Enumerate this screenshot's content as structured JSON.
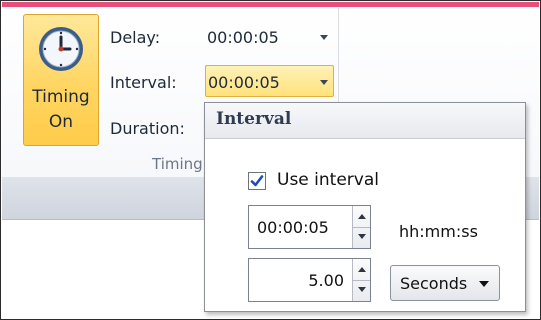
{
  "ribbon": {
    "timing_button": {
      "line1": "Timing",
      "line2": "On",
      "icon": "clock-icon"
    },
    "delay": {
      "label": "Delay:",
      "value": "00:00:05"
    },
    "interval": {
      "label": "Interval:",
      "value": "00:00:05"
    },
    "duration": {
      "label": "Duration:"
    },
    "group_label": "Timing"
  },
  "popup": {
    "title": "Interval",
    "use_interval": {
      "label": "Use interval",
      "checked": true
    },
    "time_field": {
      "value": "00:00:05",
      "format_label": "hh:mm:ss"
    },
    "number_field": {
      "value": "5.00"
    },
    "unit_dropdown": {
      "value": "Seconds"
    }
  },
  "colors": {
    "ribbon_accent": "#e84e7a",
    "selected_button": "#ffd562",
    "checkbox_check": "#1f4db3"
  }
}
